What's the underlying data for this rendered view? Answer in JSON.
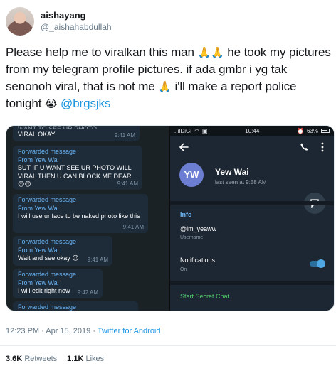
{
  "user": {
    "display_name": "aishayang",
    "handle": "@_aishahabdullah"
  },
  "tweet": {
    "part1": "Please help me to viralkan this man ",
    "emoji_pray_double": "🙏🙏",
    "part2": " he took my pictures from my telegram profile pictures. if ada gmbr i yg tak senonoh viral, that is not me ",
    "emoji_pray": "🙏",
    "part3": " i'll make a report police tonight ",
    "emoji_cry": "😭",
    "mention": "@brgsjks"
  },
  "chat": {
    "top_partial": "WANT TO SEE UR PHOTO",
    "top_text": "VIRAL OKAY",
    "top_time": "9:41 AM",
    "messages": [
      {
        "forwarded": "Forwarded message",
        "from": "From Yew Wai",
        "text": "BUT IF U WANT SEE UR PHOTO WILL VIRAL THEN U CAN BLOCK ME DEAR 😍😍",
        "time": "9:41 AM"
      },
      {
        "forwarded": "Forwarded message",
        "from": "From Yew Wai",
        "text": "I will use ur face to be naked photo like this",
        "time": "9:41 AM"
      },
      {
        "forwarded": "Forwarded message",
        "from": "From Yew Wai",
        "text": "Wait and see okay 😉",
        "time": "9:41 AM"
      },
      {
        "forwarded": "Forwarded message",
        "from": "From Yew Wai",
        "text": "I will edit right now",
        "time": "9:42 AM"
      },
      {
        "forwarded": "Forwarded message",
        "from": "",
        "text": "",
        "time": ""
      }
    ]
  },
  "profile": {
    "carrier": "..ılDiGi",
    "clock": "10:44",
    "battery": "63%",
    "avatar_initials": "YW",
    "name": "Yew Wai",
    "last_seen": "last seen at 9:58 AM",
    "info_label": "Info",
    "username": "@im_yeaww",
    "username_label": "Username",
    "notifications_label": "Notifications",
    "notifications_state": "On",
    "notifications_on": true,
    "secret_chat": "Start Secret Chat"
  },
  "meta": {
    "time": "12:23 PM",
    "date": "Apr 15, 2019",
    "separator": " · ",
    "source": "Twitter for Android"
  },
  "stats": {
    "retweets_count": "3.6K",
    "retweets_label": "Retweets",
    "likes_count": "1.1K",
    "likes_label": "Likes"
  },
  "colors": {
    "link": "#1b95e0",
    "telegram_accent": "#6ab3f3",
    "secret_chat": "#4fce6b"
  }
}
